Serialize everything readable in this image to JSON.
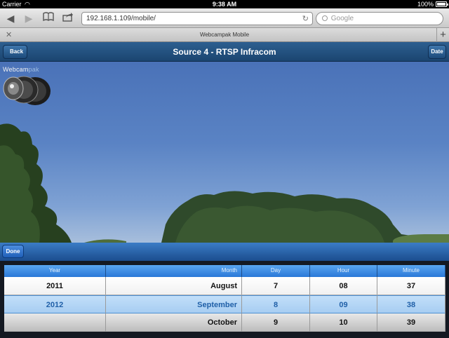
{
  "status_bar": {
    "carrier": "Carrier",
    "time": "9:38 AM",
    "battery": "100%",
    "battery_level": 1.0
  },
  "browser": {
    "url": "192.168.1.109/mobile/",
    "search_placeholder": "Google",
    "tab_title": "Webcampak Mobile"
  },
  "header": {
    "back_label": "Back",
    "title": "Source 4 - RTSP Infracom",
    "date_label": "Date"
  },
  "camera": {
    "watermark_main": "Webcam",
    "watermark_accent": "pak"
  },
  "done_label": "Done",
  "picker": {
    "columns": [
      {
        "label": "Year",
        "values": [
          "2011",
          "2012",
          ""
        ]
      },
      {
        "label": "Month",
        "values": [
          "August",
          "September",
          "October"
        ]
      },
      {
        "label": "Day",
        "values": [
          "7",
          "8",
          "9"
        ]
      },
      {
        "label": "Hour",
        "values": [
          "08",
          "09",
          "10"
        ]
      },
      {
        "label": "Minute",
        "values": [
          "37",
          "38",
          "39"
        ]
      }
    ],
    "selected_row": 1
  },
  "colors": {
    "header_blue": "#1b4570",
    "picker_selected_text": "#2060a8",
    "picker_header": "#2a78d8"
  }
}
